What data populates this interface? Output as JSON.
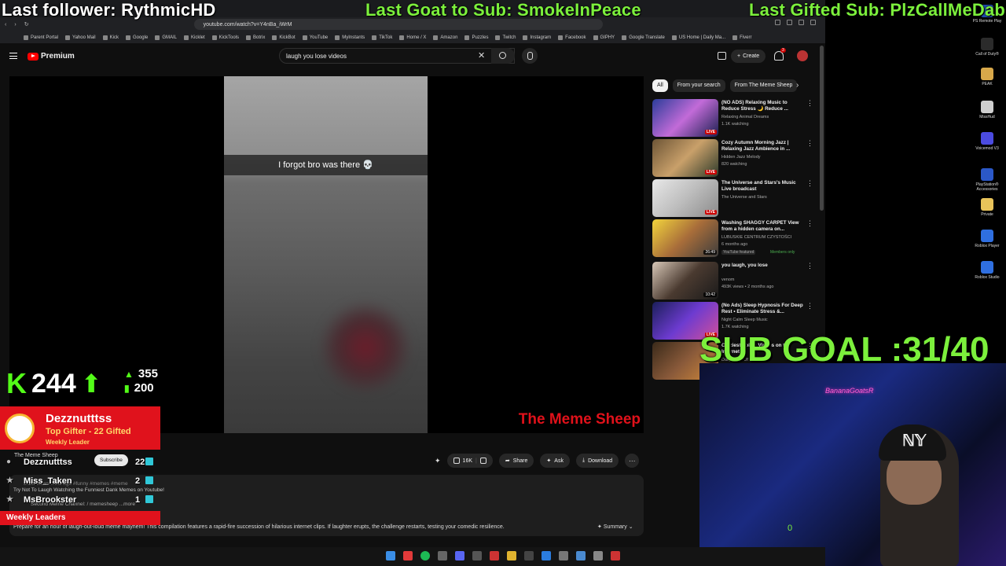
{
  "overlays": {
    "last_follower": "Last follower: RythmicHD",
    "last_goat": "Last Goat to Sub: SmokeInPeace",
    "last_gifted": "Last Gifted Sub: PlzCallMeDab",
    "sub_goal": "SUB GOAL :31/40",
    "watermark": "The Meme Sheep"
  },
  "browser": {
    "url": "youtube.com/watch?v=Y4nBa_iWrM",
    "bookmarks": [
      "Parent Portal",
      "Yahoo Mail",
      "Kick",
      "Google",
      "GMAIL",
      "Kicklet",
      "KickTools",
      "Botrix",
      "KickBot",
      "YouTube",
      "MyInstants",
      "TikTok",
      "Home / X",
      "Amazon",
      "Puzzles",
      "Twitch",
      "Instagram",
      "Facebook",
      "GIPHY",
      "Google Translate",
      "US Home | Daily Ma...",
      "Fiverr"
    ]
  },
  "youtube": {
    "logo_text": "Premium",
    "search_value": "laugh you lose videos",
    "create_label": "Create",
    "notification_count": "3"
  },
  "video": {
    "caption": "I forgot bro was there 💀",
    "channel": "The Meme Sheep",
    "subscribe": "Subscribe",
    "likes": "16K",
    "share": "Share",
    "ask": "Ask",
    "download": "Download",
    "description_meta": "3.1M views  ...ths ago  #funny #memes #meme",
    "description_line1": "Try Not To Laugh Watching the Funniest Dank Memes on Youtube!",
    "description_line2": "Second Meme Channel:  / memesheep  ...more",
    "description_line3": "Prepare for an hour of laugh-out-loud meme mayhem! This compilation features a rapid-fire succession of hilarious internet clips. If laughter erupts, the challenge restarts, testing your comedic resilience.",
    "summary": "Summary"
  },
  "sidebar": {
    "chips": [
      "All",
      "From your search",
      "From The Meme Sheep"
    ],
    "items": [
      {
        "title": "(NO ADS) Relaxing Music to Reduce Stress 🌙 Reduce ...",
        "channel": "Relaxing Animal Dreams",
        "meta": "1.1K watching",
        "badge": "LIVE"
      },
      {
        "title": "Cozy Autumn Morning Jazz | Relaxing Jazz Ambience in ...",
        "channel": "Hidden Jazz Melody",
        "meta": "820 watching",
        "badge": "LIVE"
      },
      {
        "title": "The Universe and Stars's Music Live broadcast",
        "channel": "The Universe and Stars",
        "meta": "",
        "badge": "LIVE"
      },
      {
        "title": "Washing SHAGGY CARPET View from a hidden camera on...",
        "channel": "LUBUSKIE CENTRUM CZYSTOŚCI",
        "meta": "6 months ago",
        "badge": "26:49",
        "tag": "YouTube featured",
        "tag2": "Members only"
      },
      {
        "title": "you laugh, you lose",
        "channel": "venom",
        "meta": "493K views • 2 months ago",
        "badge": "10:42"
      },
      {
        "title": "(No Ads) Sleep Hypnosis For Deep Rest • Eliminate Stress &...",
        "channel": "Night Calm Sleep Music",
        "meta": "1.7K watching",
        "badge": "LIVE"
      },
      {
        "title": "Craziest Police Videos on the Internet",
        "channel": "Daily Dose Of Internet",
        "meta": "",
        "badge": ""
      }
    ]
  },
  "kick": {
    "count": "244",
    "stat1": "355",
    "stat2": "200"
  },
  "gifter": {
    "name": "Dezznutttss",
    "line1": "Top Gifter - 22 Gifted",
    "line2": "Weekly Leader"
  },
  "leaders": {
    "rows": [
      {
        "name": "Dezznutttss",
        "count": "22"
      },
      {
        "name": "Miss_Taken",
        "count": "2"
      },
      {
        "name": "MsBrookster",
        "count": "1"
      }
    ],
    "title": "Weekly Leaders"
  },
  "desktop": {
    "icons": [
      "PS Remote Play",
      "Call of Duty®",
      "PEAK",
      "MissHud",
      "Voicemod V3",
      "PlayStation® Accessories",
      "Private",
      "Roblox Player",
      "Roblox Studio"
    ]
  },
  "webcam": {
    "neon": "BananaGoatsR",
    "counter": "0"
  }
}
